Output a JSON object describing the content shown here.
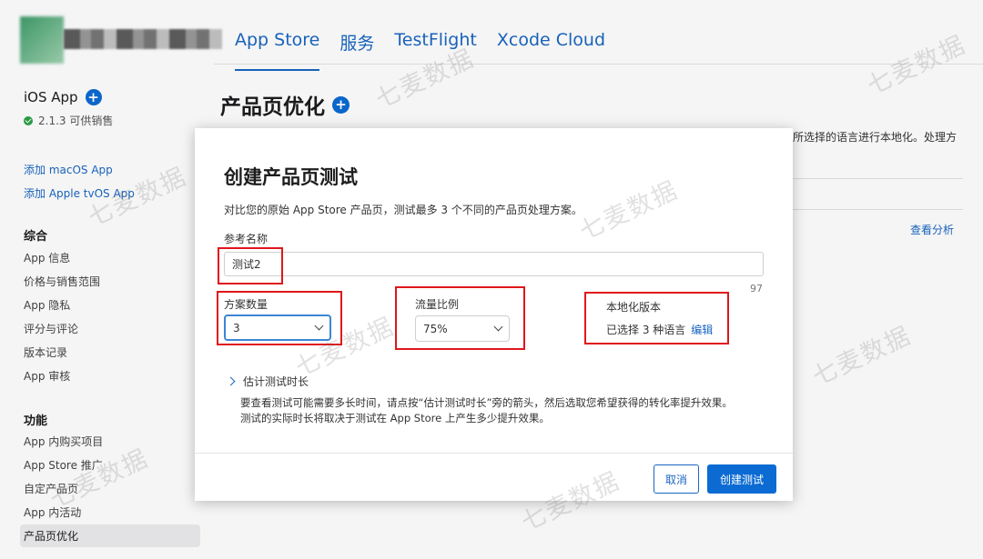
{
  "header": {
    "tabs": [
      {
        "label": "App Store",
        "active": true
      },
      {
        "label": "服务",
        "active": false
      },
      {
        "label": "TestFlight",
        "active": false
      },
      {
        "label": "Xcode Cloud",
        "active": false
      }
    ]
  },
  "sidebar": {
    "app_name": "iOS App",
    "version_status": "2.1.3 可供销售",
    "links": [
      "添加 macOS App",
      "添加 Apple tvOS App"
    ],
    "section_general": "综合",
    "general_items": [
      "App 信息",
      "价格与销售范围",
      "App 隐私",
      "评分与评论",
      "版本记录",
      "App 审核"
    ],
    "section_features": "功能",
    "feature_items": [
      "App 内购买项目",
      "App Store 推广",
      "自定产品页",
      "App 内活动",
      "产品页优化"
    ],
    "selected_item": "产品页优化"
  },
  "main": {
    "title": "产品页优化",
    "bg_text": "所选择的语言进行本地化。处理方",
    "view_analytics": "查看分析"
  },
  "modal": {
    "title": "创建产品页测试",
    "description": "对比您的原始 App Store 产品页，测试最多 3 个不同的产品页处理方案。",
    "reference_label": "参考名称",
    "reference_value": "测试2",
    "char_counter": "97",
    "treatments_label": "方案数量",
    "treatments_value": "3",
    "traffic_label": "流量比例",
    "traffic_value": "75%",
    "localization_label": "本地化版本",
    "localization_value": "已选择 3 种语言",
    "localization_edit": "编辑",
    "estimate_label": "估计测试时长",
    "estimate_desc_1": "要查看测试可能需要多长时间，请点按“估计测试时长”旁的箭头，然后选取您希望获得的转化率提升效果。",
    "estimate_desc_2": "测试的实际时长将取决于测试在 App Store 上产生多少提升效果。",
    "cancel_label": "取消",
    "create_label": "创建测试"
  },
  "watermark": "七麦数据",
  "colors": {
    "accent": "#0b6bd3",
    "link": "#1a66c2",
    "highlight_box": "#e0161b",
    "status_green": "#2aa146"
  }
}
